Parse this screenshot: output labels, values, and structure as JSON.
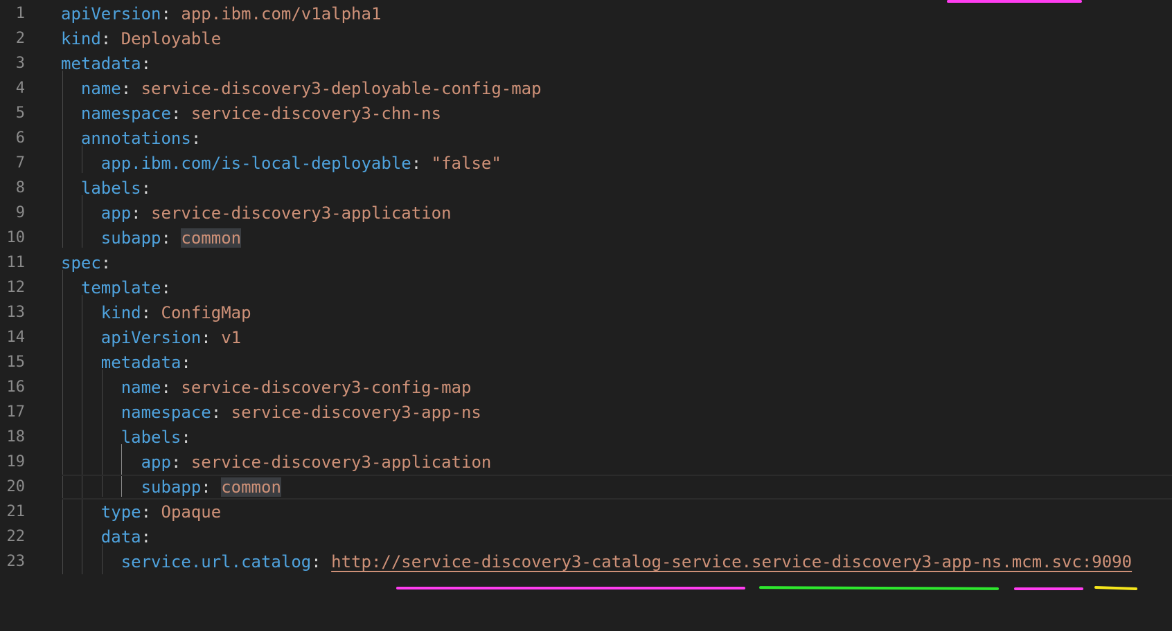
{
  "editor": {
    "lines": [
      {
        "num": "1",
        "key": "apiVersion",
        "sep": ":",
        "value": "app.ibm.com/v1alpha1",
        "vclass": "v"
      },
      {
        "num": "2",
        "key": "kind",
        "sep": ":",
        "value": "Deployable",
        "vclass": "v"
      },
      {
        "num": "3",
        "key": "metadata",
        "sep": ":",
        "value": "",
        "vclass": "v"
      },
      {
        "num": "4",
        "key": "name",
        "sep": ":",
        "value": "service-discovery3-deployable-config-map",
        "vclass": "v"
      },
      {
        "num": "5",
        "key": "namespace",
        "sep": ":",
        "value": "service-discovery3-chn-ns",
        "vclass": "v"
      },
      {
        "num": "6",
        "key": "annotations",
        "sep": ":",
        "value": "",
        "vclass": "v"
      },
      {
        "num": "7",
        "key": "app.ibm.com/is-local-deployable",
        "sep": ":",
        "value": "\"false\"",
        "vclass": "v"
      },
      {
        "num": "8",
        "key": "labels",
        "sep": ":",
        "value": "",
        "vclass": "v"
      },
      {
        "num": "9",
        "key": "app",
        "sep": ":",
        "value": "service-discovery3-application",
        "vclass": "v"
      },
      {
        "num": "10",
        "key": "subapp",
        "sep": ":",
        "value": "common",
        "vclass": "v hl"
      },
      {
        "num": "11",
        "key": "spec",
        "sep": ":",
        "value": "",
        "vclass": "v"
      },
      {
        "num": "12",
        "key": "template",
        "sep": ":",
        "value": "",
        "vclass": "v"
      },
      {
        "num": "13",
        "key": "kind",
        "sep": ":",
        "value": "ConfigMap",
        "vclass": "v"
      },
      {
        "num": "14",
        "key": "apiVersion",
        "sep": ":",
        "value": "v1",
        "vclass": "v"
      },
      {
        "num": "15",
        "key": "metadata",
        "sep": ":",
        "value": "",
        "vclass": "v"
      },
      {
        "num": "16",
        "key": "name",
        "sep": ":",
        "value": "service-discovery3-config-map",
        "vclass": "v"
      },
      {
        "num": "17",
        "key": "namespace",
        "sep": ":",
        "value": "service-discovery3-app-ns",
        "vclass": "v"
      },
      {
        "num": "18",
        "key": "labels",
        "sep": ":",
        "value": "",
        "vclass": "v"
      },
      {
        "num": "19",
        "key": "app",
        "sep": ":",
        "value": "service-discovery3-application",
        "vclass": "v"
      },
      {
        "num": "20",
        "key": "subapp",
        "sep": ":",
        "value": "common",
        "vclass": "v hl"
      },
      {
        "num": "21",
        "key": "type",
        "sep": ":",
        "value": "Opaque",
        "vclass": "v"
      },
      {
        "num": "22",
        "key": "data",
        "sep": ":",
        "value": "",
        "vclass": "v"
      },
      {
        "num": "23",
        "key": "service.url.catalog",
        "sep": ":",
        "value": "http://service-discovery3-catalog-service.service-discovery3-app-ns.mcm.svc:9090",
        "vclass": "u"
      }
    ],
    "current_line": "20"
  },
  "colors": {
    "background": "#1f1f1f",
    "key": "#4fa3de",
    "value": "#ce9178",
    "punctuation": "#d4d4d4",
    "line_number": "#8b8b8b",
    "annotation_magenta": "#ff3df0",
    "annotation_green": "#2ee82e",
    "annotation_yellow": "#f5e61c"
  }
}
